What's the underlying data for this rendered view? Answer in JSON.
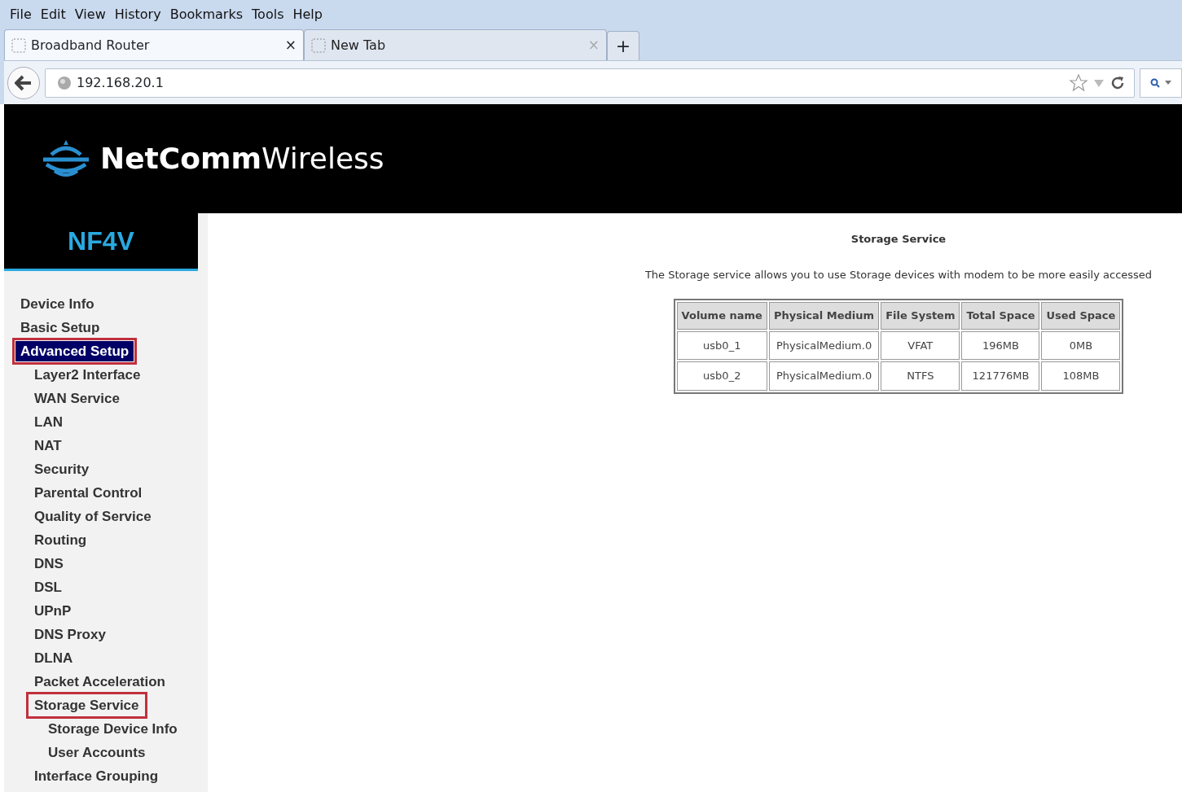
{
  "menu_bar": [
    {
      "label": "File"
    },
    {
      "label": "Edit"
    },
    {
      "label": "View"
    },
    {
      "label": "History"
    },
    {
      "label": "Bookmarks"
    },
    {
      "label": "Tools"
    },
    {
      "label": "Help"
    }
  ],
  "tabs": [
    {
      "label": "Broadband Router",
      "selected": true,
      "close": "×"
    },
    {
      "label": "New Tab",
      "selected": false,
      "close": "×"
    }
  ],
  "new_tab": "+",
  "address_bar": {
    "value": "192.168.20.1"
  },
  "header": {
    "brand_bold": "NetComm",
    "brand_light": "Wireless"
  },
  "model": "NF4V",
  "sidebar": {
    "items": [
      {
        "label": "Device Info",
        "selected": false,
        "highlighted": false
      },
      {
        "label": "Basic Setup",
        "selected": false,
        "highlighted": false
      },
      {
        "label": "Advanced Setup",
        "selected": true,
        "highlighted": true,
        "children": [
          {
            "label": "Layer2 Interface",
            "selected": false,
            "highlighted": false
          },
          {
            "label": "WAN Service",
            "selected": false,
            "highlighted": false
          },
          {
            "label": "LAN",
            "selected": false,
            "highlighted": false
          },
          {
            "label": "NAT",
            "selected": false,
            "highlighted": false
          },
          {
            "label": "Security",
            "selected": false,
            "highlighted": false
          },
          {
            "label": "Parental Control",
            "selected": false,
            "highlighted": false
          },
          {
            "label": "Quality of Service",
            "selected": false,
            "highlighted": false
          },
          {
            "label": "Routing",
            "selected": false,
            "highlighted": false
          },
          {
            "label": "DNS",
            "selected": false,
            "highlighted": false
          },
          {
            "label": "DSL",
            "selected": false,
            "highlighted": false
          },
          {
            "label": "UPnP",
            "selected": false,
            "highlighted": false
          },
          {
            "label": "DNS Proxy",
            "selected": false,
            "highlighted": false
          },
          {
            "label": "DLNA",
            "selected": false,
            "highlighted": false
          },
          {
            "label": "Packet Acceleration",
            "selected": false,
            "highlighted": false
          },
          {
            "label": "Storage Service",
            "selected": false,
            "highlighted": true,
            "children": [
              {
                "label": "Storage Device Info",
                "selected": false,
                "highlighted": false
              },
              {
                "label": "User Accounts",
                "selected": false,
                "highlighted": false
              }
            ]
          },
          {
            "label": "Interface Grouping",
            "selected": false,
            "highlighted": false
          }
        ]
      }
    ]
  },
  "content": {
    "title": "Storage Service",
    "description": "The Storage service allows you to use Storage devices with modem to be more easily accessed",
    "table": {
      "columns": [
        "Volume name",
        "Physical Medium",
        "File System",
        "Total Space",
        "Used Space"
      ],
      "rows": [
        [
          "usb0_1",
          "PhysicalMedium.0",
          "VFAT",
          "196MB",
          "0MB"
        ],
        [
          "usb0_2",
          "PhysicalMedium.0",
          "NTFS",
          "121776MB",
          "108MB"
        ]
      ]
    }
  }
}
